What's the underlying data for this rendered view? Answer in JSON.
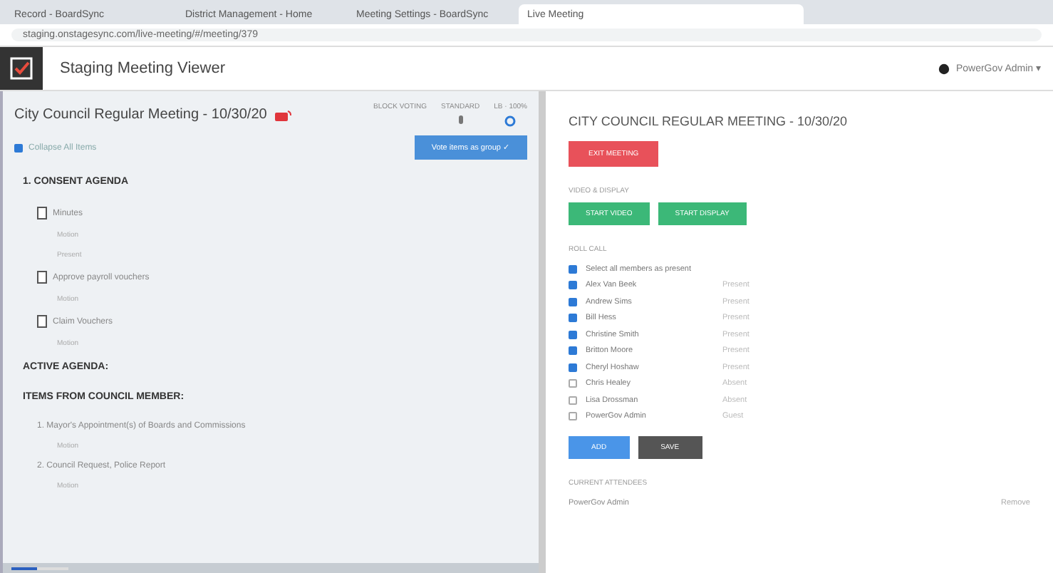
{
  "browser": {
    "tabs": [
      {
        "title": "Record - BoardSync",
        "selected": false
      },
      {
        "title": "District Management - Home",
        "selected": false
      },
      {
        "title": "Meeting Settings - BoardSync",
        "selected": false
      },
      {
        "title": "Live Meeting",
        "selected": true
      }
    ],
    "url": "staging.onstagesync.com/live-meeting/#/meeting/379"
  },
  "app": {
    "title": "Staging Meeting Viewer",
    "user": "PowerGov Admin ▾"
  },
  "agenda": {
    "title": "City Council Regular Meeting - 10/30/20",
    "header_labels": [
      "BLOCK VOTING",
      "STANDARD",
      "LB · 100%"
    ],
    "collapse": {
      "label": "Collapse All Items",
      "checked": true
    },
    "group_button": "Vote items as group ✓",
    "sections": [
      {
        "title": "1. CONSENT AGENDA",
        "items": [
          {
            "label": "Minutes",
            "notes": [
              "Motion",
              "Present"
            ]
          },
          {
            "label": "Approve payroll vouchers",
            "notes": [
              "Motion"
            ]
          },
          {
            "label": "Claim Vouchers",
            "notes": [
              "Motion"
            ]
          }
        ]
      },
      {
        "title": "ACTIVE AGENDA:"
      },
      {
        "title": "ITEMS FROM COUNCIL MEMBER:",
        "items": [
          {
            "label": "1. Mayor's Appointment(s) of Boards and Commissions",
            "notes": [
              "Motion"
            ]
          },
          {
            "label": "2. Council Request, Police Report",
            "notes": [
              "Motion"
            ]
          }
        ]
      }
    ],
    "zoom": {
      "level": 0.45
    }
  },
  "panel": {
    "title": "CITY COUNCIL REGULAR MEETING - 10/30/20",
    "exit_button": "EXIT MEETING",
    "video_label": "VIDEO & DISPLAY",
    "video_buttons": [
      "START VIDEO",
      "START DISPLAY"
    ],
    "roll_label": "ROLL CALL",
    "select_all": {
      "label": "Select all members as present",
      "checked": true
    },
    "members": [
      {
        "name": "Alex Van Beek",
        "status": "Present",
        "checked": true
      },
      {
        "name": "Andrew Sims",
        "status": "Present",
        "checked": true
      },
      {
        "name": "Bill Hess",
        "status": "Present",
        "checked": true
      },
      {
        "name": "Christine Smith",
        "status": "Present",
        "checked": true
      },
      {
        "name": "Britton Moore",
        "status": "Present",
        "checked": true
      },
      {
        "name": "Cheryl Hoshaw",
        "status": "Present",
        "checked": true
      },
      {
        "name": "Chris Healey",
        "status": "Absent",
        "checked": false
      },
      {
        "name": "Lisa Drossman",
        "status": "Absent",
        "checked": false
      },
      {
        "name": "PowerGov Admin",
        "status": "Guest",
        "checked": false
      }
    ],
    "add_button": "ADD",
    "save_button": "SAVE",
    "attendees_label": "CURRENT ATTENDEES",
    "attendees": [
      {
        "name": "PowerGov Admin",
        "action": "Remove"
      }
    ]
  }
}
